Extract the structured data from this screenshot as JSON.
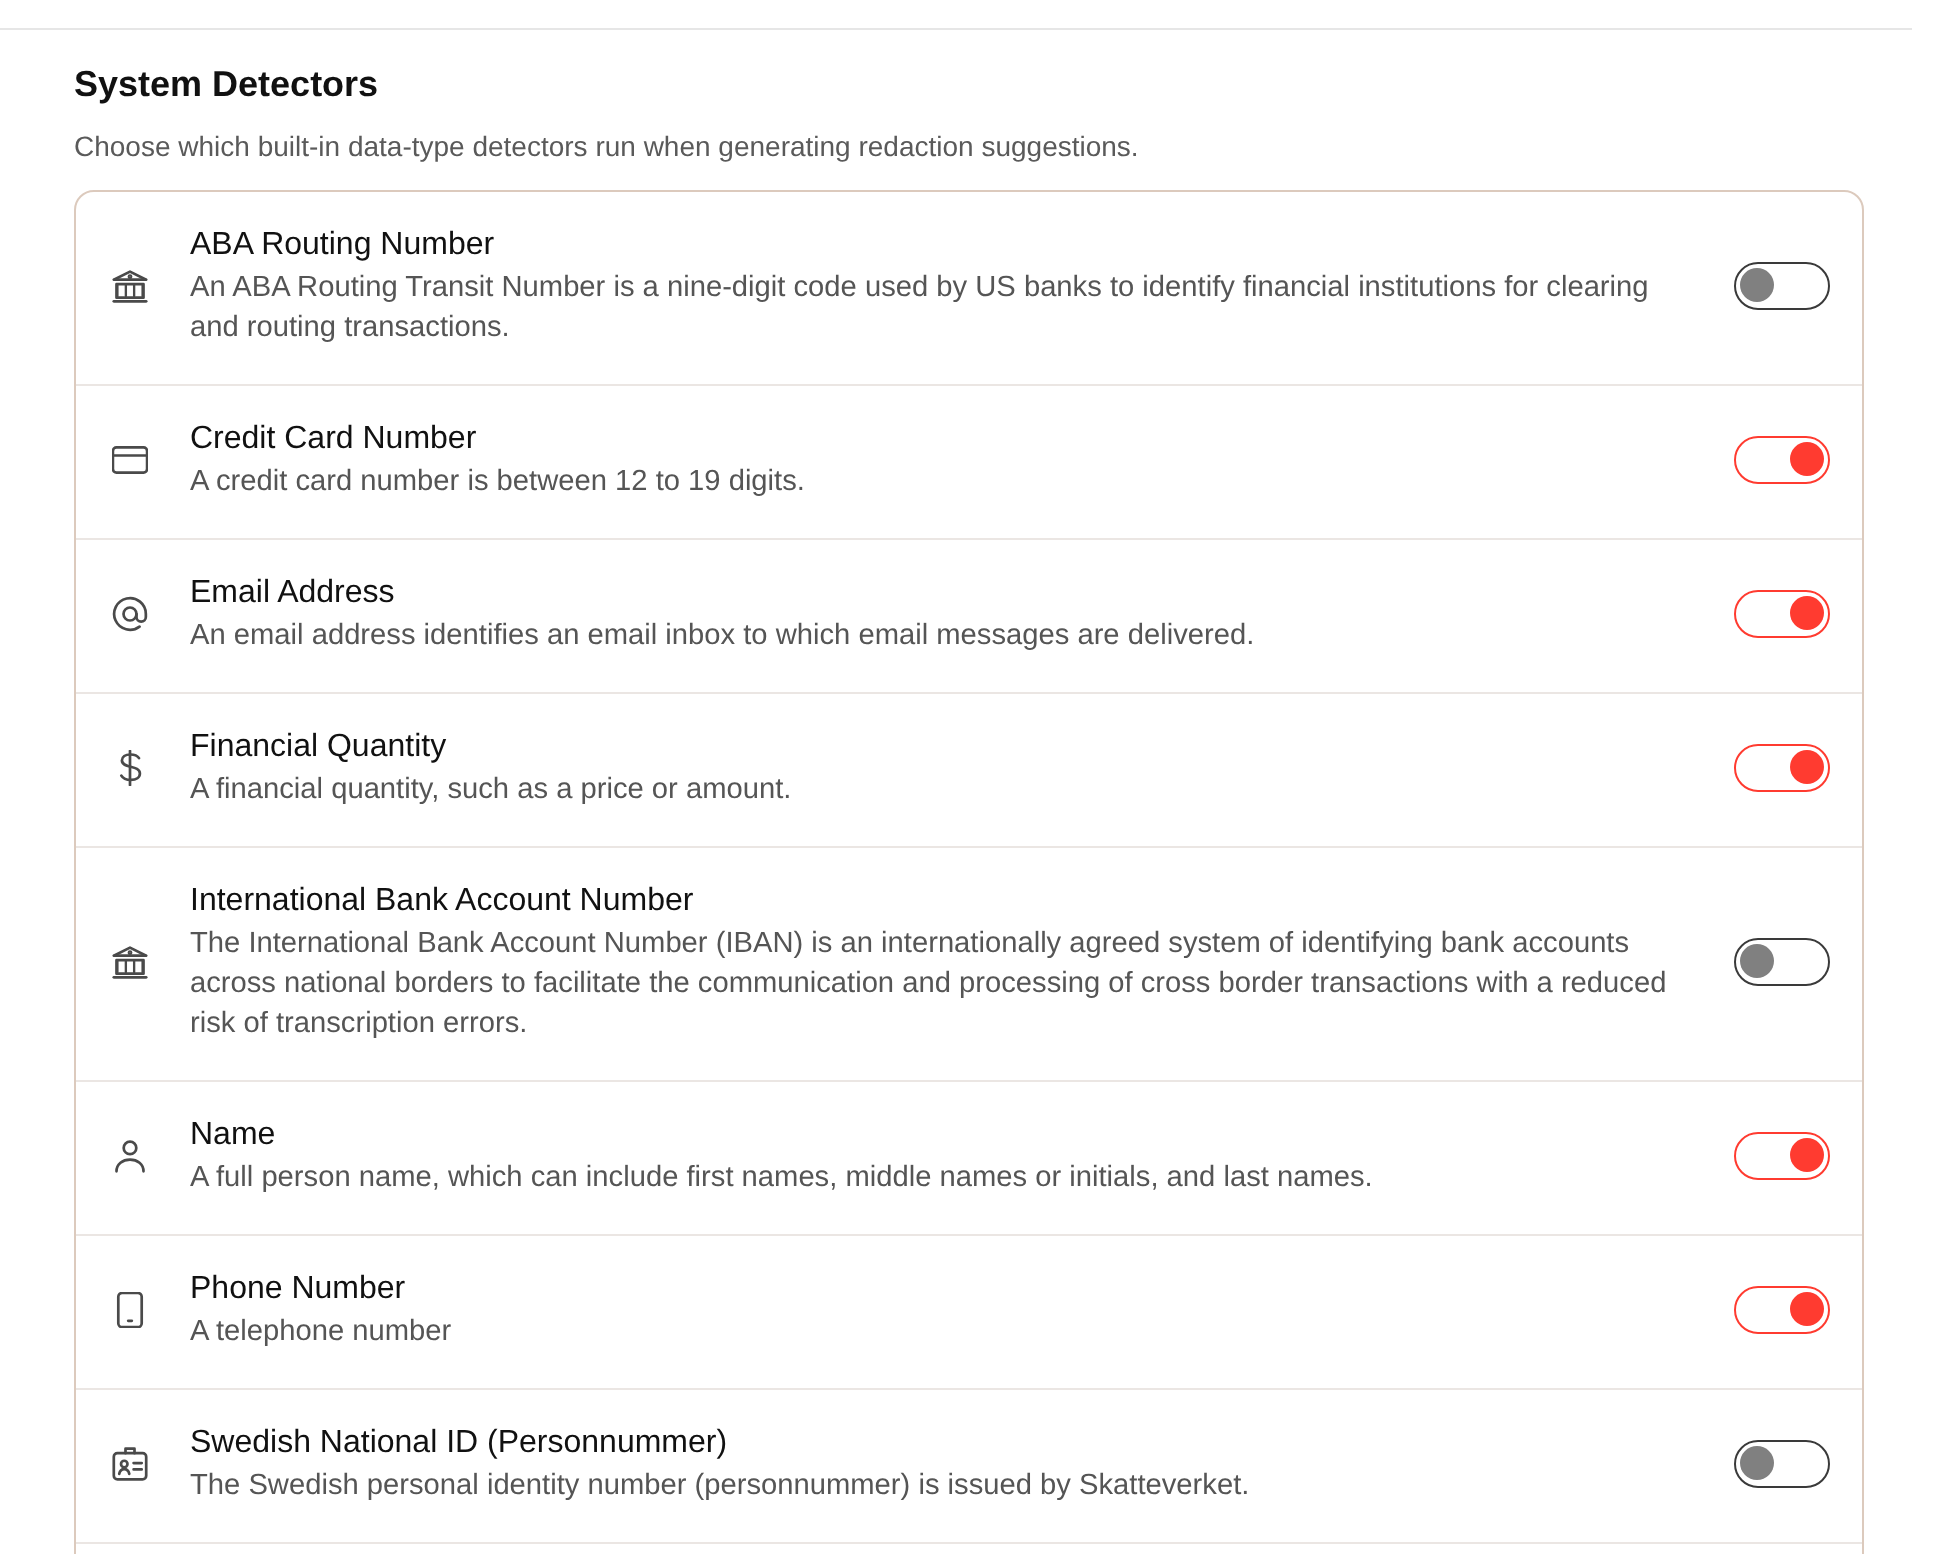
{
  "section": {
    "title": "System Detectors",
    "description": "Choose which built-in data-type detectors run when generating redaction suggestions."
  },
  "detectors": [
    {
      "kind": "bank",
      "name": "ABA Routing Number",
      "description": "An ABA Routing Transit Number is a nine-digit code used by US banks to identify financial institutions for clearing and routing transactions.",
      "on": false
    },
    {
      "kind": "card",
      "name": "Credit Card Number",
      "description": "A credit card number is between 12 to 19 digits.",
      "on": true
    },
    {
      "kind": "email",
      "name": "Email Address",
      "description": "An email address identifies an email inbox to which email messages are delivered.",
      "on": true
    },
    {
      "kind": "currency",
      "name": "Financial Quantity",
      "description": "A financial quantity, such as a price or amount.",
      "on": true
    },
    {
      "kind": "bank",
      "name": "International Bank Account Number",
      "description": "The International Bank Account Number (IBAN) is an internationally agreed system of identifying bank accounts across national borders to facilitate the communication and processing of cross border transactions with a reduced risk of transcription errors.",
      "on": false
    },
    {
      "kind": "person",
      "name": "Name",
      "description": "A full person name, which can include first names, middle names or initials, and last names.",
      "on": true
    },
    {
      "kind": "phone",
      "name": "Phone Number",
      "description": "A telephone number",
      "on": true
    },
    {
      "kind": "id",
      "name": "Swedish National ID (Personnummer)",
      "description": "The Swedish personal identity number (personnummer) is issued by Skatteverket.",
      "on": false
    }
  ]
}
